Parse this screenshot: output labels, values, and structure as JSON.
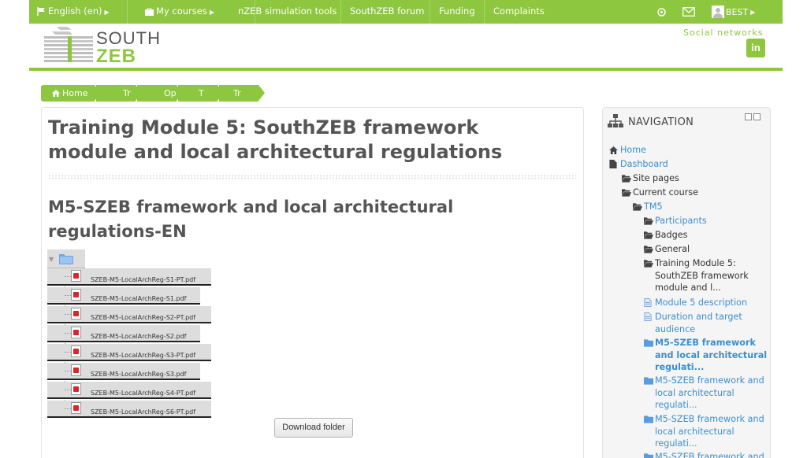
{
  "topnav": {
    "language": "English (en)",
    "my_courses": "My courses",
    "simulation": "nZEB simulation tools",
    "forum": "SouthZEB forum",
    "funding": "Funding",
    "complaints": "Complaints",
    "user": "BEST"
  },
  "header": {
    "logo_south": "SOUTH",
    "logo_zeb": "ZEB",
    "social_label": "Social networks",
    "linkedin": "in"
  },
  "breadcrumb": [
    "Home",
    "Tr",
    "Op",
    "T",
    "Tr"
  ],
  "main": {
    "title": "Training Module 5: SouthZEB framework module and local architectural regulations",
    "subtitle": "M5-SZEB framework and local architectural regulations-EN",
    "files": [
      "SZEB-M5-LocalArchReg-S1-PT.pdf",
      "SZEB-M5-LocalArchReg-S1.pdf",
      "SZEB-M5-LocalArchReg-S2-PT.pdf",
      "SZEB-M5-LocalArchReg-S2.pdf",
      "SZEB-M5-LocalArchReg-S3-PT.pdf",
      "SZEB-M5-LocalArchReg-S3.pdf",
      "SZEB-M5-LocalArchReg-S4-PT.pdf",
      "SZEB-M5-LocalArchReg-S6-PT.pdf"
    ],
    "download_label": "Download folder"
  },
  "navigation": {
    "title": "NAVIGATION",
    "items": [
      {
        "label": "Home",
        "icon": "home-icon"
      },
      {
        "label": "Dashboard",
        "icon": "document-icon"
      },
      {
        "label": "Site pages",
        "icon": "folder-open-icon"
      },
      {
        "label": "Current course",
        "icon": "folder-open-icon"
      },
      {
        "label": "TM5",
        "icon": "folder-open-icon"
      },
      {
        "label": "Participants",
        "icon": "folder-open-icon"
      },
      {
        "label": "Badges",
        "icon": "folder-open-icon"
      },
      {
        "label": "General",
        "icon": "folder-open-icon"
      },
      {
        "label": "Training Module 5: SouthZEB framework module and l...",
        "icon": "folder-open-icon"
      },
      {
        "label": "Module 5 description",
        "icon": "page-icon"
      },
      {
        "label": "Duration and target audience",
        "icon": "page-icon"
      },
      {
        "label": "M5-SZEB framework and local architectural regulati...",
        "icon": "folder-icon"
      },
      {
        "label": "M5-SZEB framework and local architectural regulati...",
        "icon": "folder-icon"
      },
      {
        "label": "M5-SZEB framework and local architectural regulati...",
        "icon": "folder-icon"
      },
      {
        "label": "M5-SZEB framework and",
        "icon": "folder-icon"
      }
    ]
  },
  "colors": {
    "brand_green": "#8dc63f",
    "link_blue": "#3b8ed0"
  }
}
